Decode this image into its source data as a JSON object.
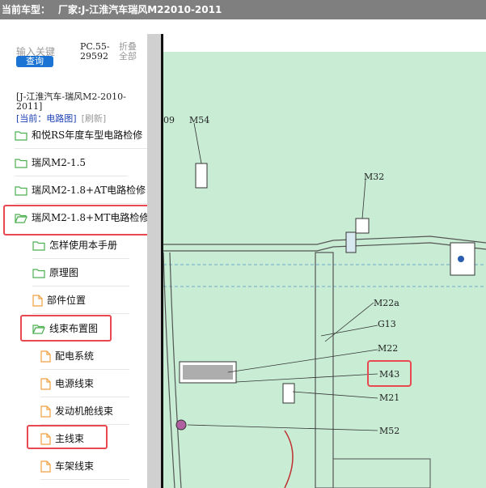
{
  "header": {
    "car_label": "当前车型：",
    "maker_label": "厂家:J-江淮汽车瑞风M22010-2011"
  },
  "sidebar": {
    "search_placeholder": "输入关键",
    "search_button": "查询",
    "pc_line1": "PC.55-",
    "pc_line2": "29592",
    "fold_line1": "折叠",
    "fold_line2": "全部",
    "model_line1": "[J-江淮汽车-瑞风M2-2010-",
    "model_line2": "2011]",
    "current_label": "[当前：电路图]",
    "refresh_label": "[刷新]",
    "items": [
      {
        "label": "和悦RS年度车型电路检修",
        "icon": "folder-icon"
      },
      {
        "label": "瑞风M2-1.5",
        "icon": "folder-icon"
      },
      {
        "label": "瑞风M2-1.8+AT电路检修",
        "icon": "folder-icon"
      },
      {
        "label": "瑞风M2-1.8+MT电路检修",
        "icon": "folder-open-icon"
      },
      {
        "label": "怎样使用本手册",
        "icon": "folder-icon"
      },
      {
        "label": "原理图",
        "icon": "folder-icon"
      },
      {
        "label": "部件位置",
        "icon": "document-icon"
      },
      {
        "label": "线束布置图",
        "icon": "folder-open-icon"
      },
      {
        "label": "配电系统",
        "icon": "document-icon"
      },
      {
        "label": "电源线束",
        "icon": "document-icon"
      },
      {
        "label": "发动机舱线束",
        "icon": "document-icon"
      },
      {
        "label": "主线束",
        "icon": "document-icon"
      },
      {
        "label": "车架线束",
        "icon": "document-icon"
      }
    ]
  },
  "diagram": {
    "labels": [
      "09",
      "M54",
      "M32",
      "M22a",
      "G13",
      "M22",
      "M43",
      "M21",
      "M52"
    ],
    "highlighted_label": "M43",
    "bg_color": "#c8ecd4",
    "highlight_color": "#e8484f"
  }
}
